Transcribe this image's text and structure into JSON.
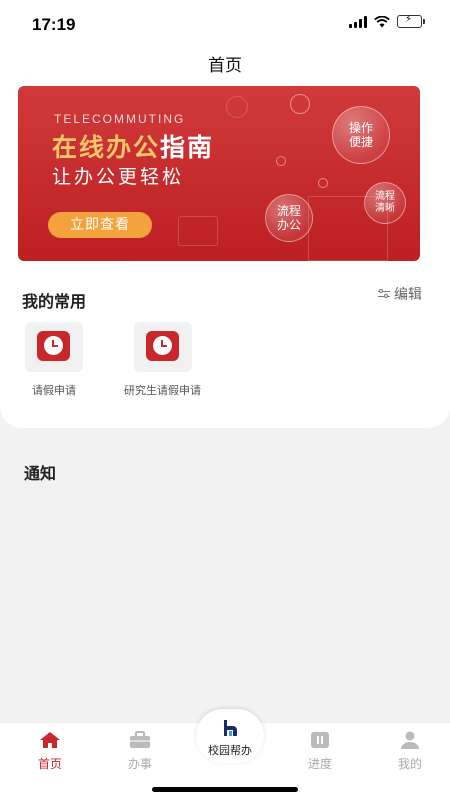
{
  "status_bar": {
    "time": "17:19"
  },
  "header": {
    "title": "首页"
  },
  "banner": {
    "english_tag": "TELECOMMUTING",
    "title_gold": "在线办公",
    "title_white": "指南",
    "subtitle": "让办公更轻松",
    "button_label": "立即查看",
    "bubbles": [
      "操作\n便捷",
      "流程\n清晰",
      "流程\n办公"
    ]
  },
  "favorites": {
    "title": "我的常用",
    "edit_label": "编辑",
    "items": [
      {
        "label": "请假申请",
        "icon": "clock-icon"
      },
      {
        "label": "研究生请假申请",
        "icon": "clock-icon"
      }
    ]
  },
  "notice": {
    "title": "通知"
  },
  "tabbar": {
    "items": [
      {
        "label": "首页",
        "icon": "home-icon",
        "active": true
      },
      {
        "label": "办事",
        "icon": "briefcase-icon"
      },
      {
        "label": "校园帮办",
        "icon": "campus-logo-icon"
      },
      {
        "label": "进度",
        "icon": "progress-icon"
      },
      {
        "label": "我的",
        "icon": "user-icon"
      }
    ]
  },
  "colors": {
    "brand_red": "#c8282b",
    "banner_button": "#f4a23c",
    "title_gold": "#f7c66b"
  }
}
